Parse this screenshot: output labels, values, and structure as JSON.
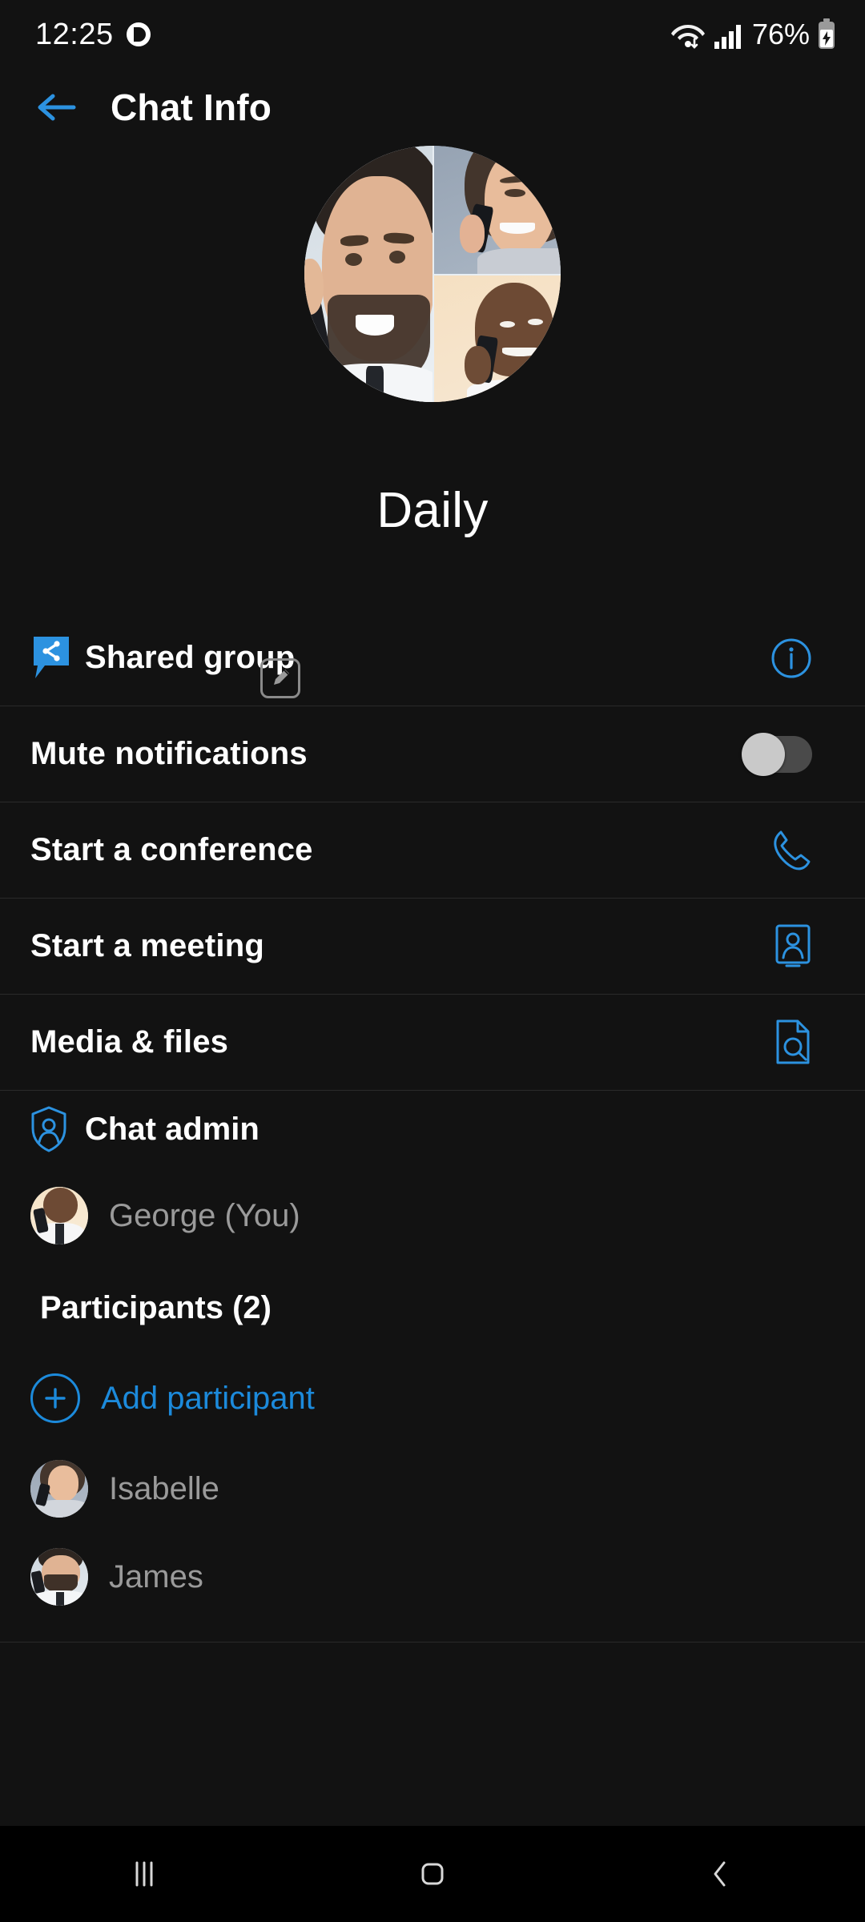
{
  "colors": {
    "accent": "#1c8adb",
    "background": "#121212",
    "navbar_background": "#000000",
    "divider": "#2a2a2a",
    "primary_text": "#ffffff",
    "secondary_text": "#9a9a9a",
    "toggle_track_off": "#4a4a4a",
    "toggle_knob_off": "#c9c9c9"
  },
  "status_bar": {
    "time": "12:25",
    "battery_percent": "76%",
    "icons": {
      "app": "app-circle-icon",
      "wifi": "wifi-data-icon",
      "signal": "cellular-signal-icon",
      "battery": "battery-charging-icon"
    }
  },
  "app_bar": {
    "back_icon": "back-arrow-icon",
    "title": "Chat Info"
  },
  "profile": {
    "avatar_name": "group-avatar-collage",
    "avatar_tiles": [
      "bearded-man-on-phone",
      "woman-on-phone",
      "bald-man-on-phone"
    ],
    "edit_icon": "edit-pencil-icon",
    "group_name": "Daily"
  },
  "menu": {
    "rows": [
      {
        "label": "Shared group",
        "lead_icon": "shared-group-bubble-icon",
        "trail_icon": "info-circle-icon",
        "trail_type": "icon"
      },
      {
        "label": "Mute notifications",
        "lead_icon": "",
        "trail_icon": "toggle-switch",
        "trail_type": "toggle",
        "toggle_state": "off"
      },
      {
        "label": "Start a conference",
        "lead_icon": "",
        "trail_icon": "phone-handset-icon",
        "trail_type": "icon"
      },
      {
        "label": "Start a meeting",
        "lead_icon": "",
        "trail_icon": "meeting-person-frame-icon",
        "trail_type": "icon"
      },
      {
        "label": "Media & files",
        "lead_icon": "",
        "trail_icon": "document-search-icon",
        "trail_type": "icon"
      }
    ]
  },
  "admin_section": {
    "icon": "shield-person-icon",
    "title": "Chat admin",
    "member": {
      "name": "George (You)",
      "avatar": "george-avatar"
    }
  },
  "participants_section": {
    "title": "Participants (2)",
    "add": {
      "icon": "plus-circle-icon",
      "label": "Add participant"
    },
    "members": [
      {
        "name": "Isabelle",
        "avatar": "isabelle-avatar"
      },
      {
        "name": "James",
        "avatar": "james-avatar"
      }
    ]
  },
  "nav_bar": {
    "recents_icon": "recents-bars-icon",
    "home_icon": "home-square-icon",
    "back_icon": "nav-back-chevron-icon"
  }
}
